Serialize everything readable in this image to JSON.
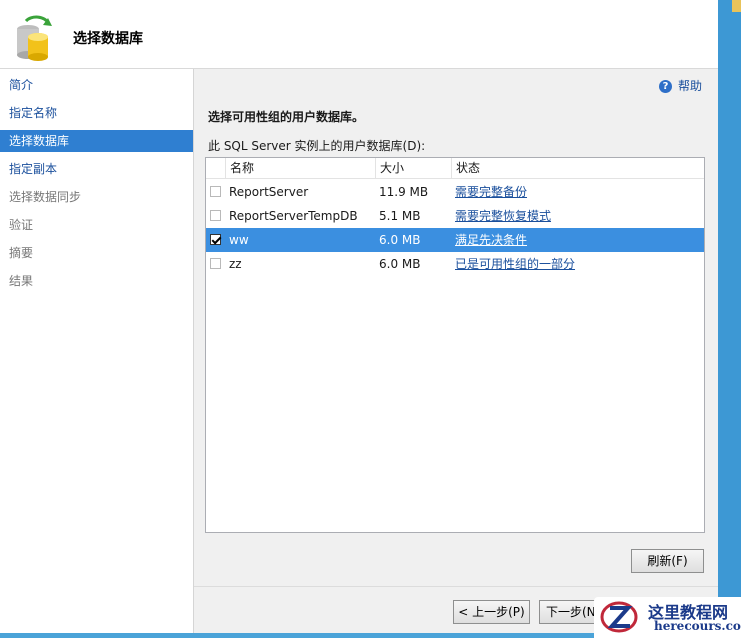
{
  "header": {
    "title": "选择数据库",
    "icon": "database-sync-icon"
  },
  "sidebar": {
    "items": [
      {
        "label": "简介",
        "state": "link"
      },
      {
        "label": "指定名称",
        "state": "link"
      },
      {
        "label": "选择数据库",
        "state": "active"
      },
      {
        "label": "指定副本",
        "state": "link"
      },
      {
        "label": "选择数据同步",
        "state": "disabled"
      },
      {
        "label": "验证",
        "state": "disabled"
      },
      {
        "label": "摘要",
        "state": "disabled"
      },
      {
        "label": "结果",
        "state": "disabled"
      }
    ]
  },
  "main": {
    "help_label": "帮助",
    "section_title": "选择可用性组的用户数据库。",
    "list_label": "此 SQL Server 实例上的用户数据库(D):",
    "columns": [
      "名称",
      "大小",
      "状态"
    ],
    "rows": [
      {
        "checked": false,
        "name": "ReportServer",
        "size": "11.9 MB",
        "status": "需要完整备份",
        "selected": false
      },
      {
        "checked": false,
        "name": "ReportServerTempDB",
        "size": "5.1 MB",
        "status": "需要完整恢复模式",
        "selected": false
      },
      {
        "checked": true,
        "name": "ww",
        "size": "6.0 MB",
        "status": "满足先决条件",
        "selected": true
      },
      {
        "checked": false,
        "name": "zz",
        "size": "6.0 MB",
        "status": "已是可用性组的一部分",
        "selected": false
      }
    ],
    "refresh_label": "刷新(F)"
  },
  "footer": {
    "prev_label": "< 上一步(P)",
    "next_label": "下一步(N"
  },
  "watermark": {
    "title": "这里教程网",
    "subtitle": "herecours.com"
  },
  "colors": {
    "accent": "#2f7fd1",
    "selected_row": "#3b8fe0",
    "link": "#1a4f9c"
  }
}
